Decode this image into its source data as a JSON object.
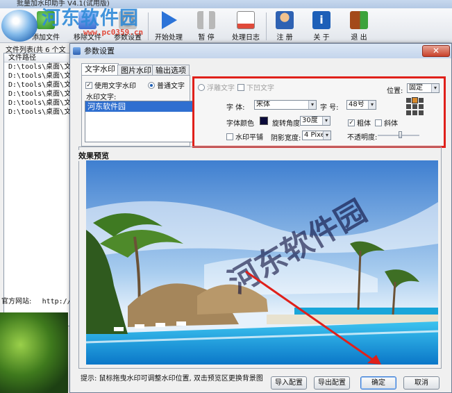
{
  "main_window": {
    "title": "批量加水印助手 V4.1(试用版)",
    "toolbar": [
      {
        "label": "添加文件",
        "icon": "add-file-icon"
      },
      {
        "label": "移除文件",
        "icon": "remove-file-icon"
      },
      {
        "label": "参数设置",
        "icon": "gear-icon"
      },
      {
        "label": "开始处理",
        "icon": "play-icon"
      },
      {
        "label": "暂 停",
        "icon": "pause-icon"
      },
      {
        "label": "处理日志",
        "icon": "log-icon"
      },
      {
        "label": "注 册",
        "icon": "register-icon"
      },
      {
        "label": "关 于",
        "icon": "info-icon"
      },
      {
        "label": "退 出",
        "icon": "exit-icon"
      }
    ],
    "file_list_title": "文件列表(共 6 个文",
    "file_list_header": "文件路径",
    "file_rows": [
      "D:\\tools\\桌面\\文件",
      "D:\\tools\\桌面\\文件",
      "D:\\tools\\桌面\\文件",
      "D:\\tools\\桌面\\文件",
      "D:\\tools\\桌面\\文件",
      "D:\\tools\\桌面\\文件"
    ],
    "website_label": "官方网站:",
    "website_url": "http://"
  },
  "overlay_watermark": {
    "logo_text": "河东软件园",
    "url": "www.pc0359.cn"
  },
  "dialog": {
    "title": "参数设置",
    "close_label": "✕",
    "tabs": [
      {
        "label": "文字水印",
        "active": true
      },
      {
        "label": "图片水印",
        "active": false
      },
      {
        "label": "输出选项",
        "active": false
      }
    ],
    "use_text_watermark": {
      "label": "使用文字水印",
      "checked": true
    },
    "normal_text": {
      "label": "普通文字",
      "selected": true
    },
    "watermark_text_label": "水印文字:",
    "watermark_items": [
      "河东软件园"
    ],
    "relief_text": {
      "label": "浮雕文字",
      "selected": false
    },
    "shadow_text": {
      "label": "下凹文字",
      "checked": false
    },
    "position": {
      "label": "位置:",
      "value": "固定",
      "selected_cell": 1
    },
    "font": {
      "label": "字  体:",
      "value": "宋体"
    },
    "size": {
      "label": "字  号:",
      "value": "48号"
    },
    "color": {
      "label": "字体颜色",
      "value": "#0b0b3a"
    },
    "rotation": {
      "label": "旋转角度",
      "value": "30度"
    },
    "bold": {
      "label": "粗体",
      "checked": true
    },
    "italic": {
      "label": "斜体",
      "checked": false
    },
    "tile": {
      "label": "水印平铺",
      "checked": false
    },
    "shadow_width": {
      "label": "阴影宽度:",
      "value": "4 Pixel"
    },
    "opacity": {
      "label": "不透明度:",
      "value": 0.55
    },
    "preview_title": "效果预览",
    "preview_watermark": "河东软件园",
    "hint": "提示: 鼠标拖曳水印可调整水印位置, 双击预览区更换背景图",
    "buttons": {
      "import": "导入配置",
      "export": "导出配置",
      "ok": "确定",
      "cancel": "取消"
    }
  },
  "colors": {
    "highlight_box": "#e0201a",
    "arrow": "#e0201a",
    "selection": "#2f6fd0"
  }
}
